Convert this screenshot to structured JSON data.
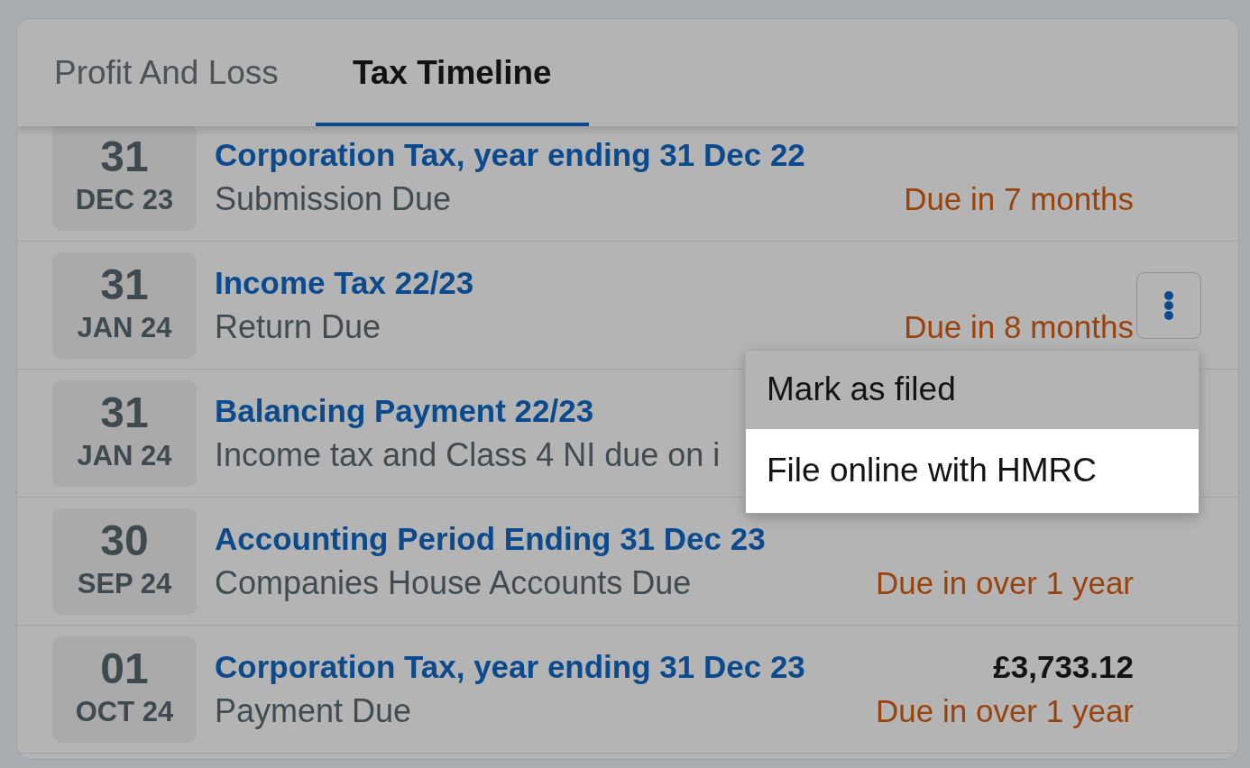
{
  "tabs": [
    {
      "label": "Profit And Loss",
      "selected": false
    },
    {
      "label": "Tax Timeline",
      "selected": true
    }
  ],
  "rows": [
    {
      "day": "31",
      "month": "DEC 23",
      "title": "Corporation Tax, year ending 31 Dec 22",
      "subtitle": "Submission Due",
      "due": "Due in 7 months",
      "menu_open": false
    },
    {
      "day": "31",
      "month": "JAN 24",
      "title": "Income Tax 22/23",
      "subtitle": "Return Due",
      "due": "Due in 8 months",
      "menu_open": true
    },
    {
      "day": "31",
      "month": "JAN 24",
      "title": "Balancing Payment 22/23",
      "subtitle": "Income tax and Class 4 NI due on i",
      "menu_open": false
    },
    {
      "day": "30",
      "month": "SEP 24",
      "title": "Accounting Period Ending 31 Dec 23",
      "subtitle": "Companies House Accounts Due",
      "due": "Due in over 1 year",
      "menu_open": false
    },
    {
      "day": "01",
      "month": "OCT 24",
      "title": "Corporation Tax, year ending 31 Dec 23",
      "subtitle": "Payment Due",
      "amount": "£3,733.12",
      "due": "Due in over 1 year",
      "menu_open": false
    }
  ],
  "row_menu": {
    "items": [
      {
        "label": "Mark as filed",
        "highlighted": false
      },
      {
        "label": "File online with HMRC",
        "highlighted": true
      }
    ]
  }
}
